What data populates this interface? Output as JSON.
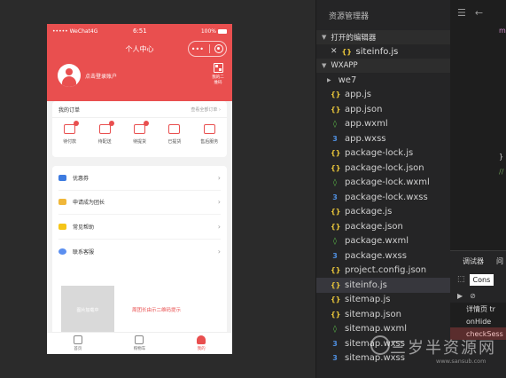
{
  "phone": {
    "status": {
      "carrier": "••••• WeChat4G",
      "time": "6:51",
      "battery": "100%"
    },
    "nav_title": "个人中心",
    "profile": {
      "login_text": "点击登录账户",
      "qr_label": "我的二维码"
    },
    "orders": {
      "title": "我的订单",
      "view_all": "查看全部订单 ›",
      "items": [
        {
          "label": "待付款",
          "badge": true
        },
        {
          "label": "待配送",
          "badge": true
        },
        {
          "label": "待提货",
          "badge": true
        },
        {
          "label": "已提货",
          "badge": false
        },
        {
          "label": "售后服务",
          "badge": false
        }
      ]
    },
    "menu": [
      {
        "label": "优惠券",
        "color": "#3d7be0"
      },
      {
        "label": "申请成为团长",
        "color": "#f0b73a"
      },
      {
        "label": "常见帮助",
        "color": "#f5c518"
      },
      {
        "label": "联系客服",
        "color": "#5b8ff0"
      }
    ],
    "promo": {
      "image_text": "图片加载中",
      "text": "周团长由示二维码提示"
    },
    "tabbar": [
      {
        "label": "首页",
        "active": false
      },
      {
        "label": "购物车",
        "active": false
      },
      {
        "label": "我的",
        "active": true
      }
    ]
  },
  "explorer": {
    "title": "资源管理器",
    "open_editors_label": "打开的编辑器",
    "open_file": "siteinfo.js",
    "project_label": "WXAPP",
    "files": [
      {
        "name": "we7",
        "type": "folder"
      },
      {
        "name": "app.js",
        "type": "js"
      },
      {
        "name": "app.json",
        "type": "json"
      },
      {
        "name": "app.wxml",
        "type": "wxml"
      },
      {
        "name": "app.wxss",
        "type": "wxss"
      },
      {
        "name": "package-lock.js",
        "type": "js"
      },
      {
        "name": "package-lock.json",
        "type": "json"
      },
      {
        "name": "package-lock.wxml",
        "type": "wxml"
      },
      {
        "name": "package-lock.wxss",
        "type": "wxss"
      },
      {
        "name": "package.js",
        "type": "js"
      },
      {
        "name": "package.json",
        "type": "json"
      },
      {
        "name": "package.wxml",
        "type": "wxml"
      },
      {
        "name": "package.wxss",
        "type": "wxss"
      },
      {
        "name": "project.config.json",
        "type": "json"
      },
      {
        "name": "siteinfo.js",
        "type": "js",
        "selected": true
      },
      {
        "name": "sitemap.js",
        "type": "js"
      },
      {
        "name": "sitemap.json",
        "type": "json"
      },
      {
        "name": "sitemap.wxml",
        "type": "wxml"
      },
      {
        "name": "sitemap.wxss",
        "type": "wxss"
      },
      {
        "name": "sitemap.wxss",
        "type": "wxss"
      }
    ]
  },
  "debugger": {
    "tab_label": "调试器",
    "tab_label2": "问",
    "console_tab": "Cons",
    "console_lines": [
      "详情页 tr",
      "onHide",
      "checkSess"
    ]
  },
  "editor": {
    "code_snippets": [
      "mo",
      "}",
      "//"
    ]
  },
  "watermark": {
    "text": "三岁半资源网",
    "url": "www.sansub.com"
  }
}
